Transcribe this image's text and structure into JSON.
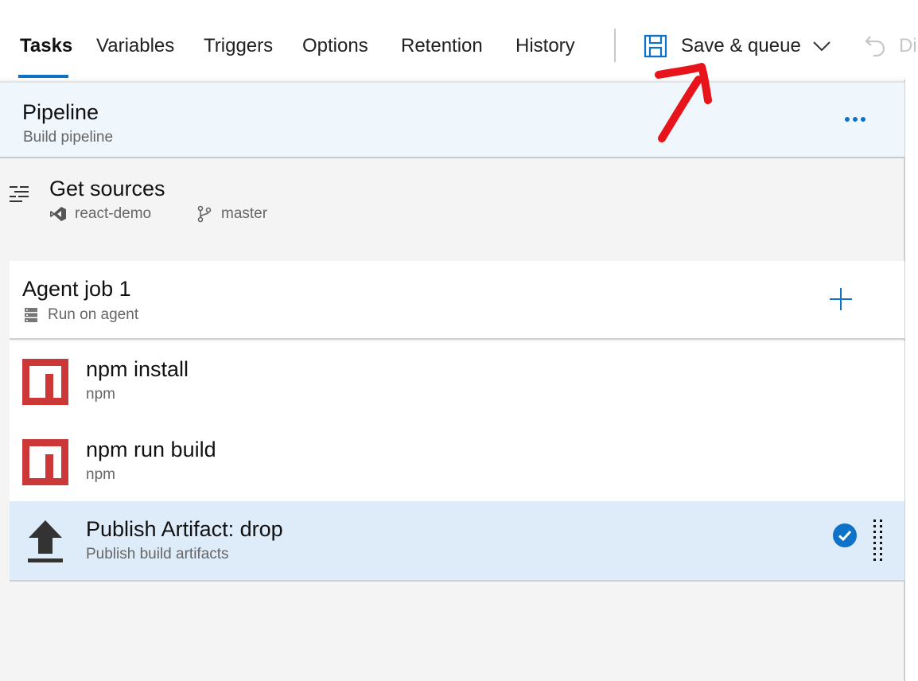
{
  "tabs": [
    {
      "label": "Tasks",
      "active": true
    },
    {
      "label": "Variables"
    },
    {
      "label": "Triggers"
    },
    {
      "label": "Options"
    },
    {
      "label": "Retention"
    },
    {
      "label": "History"
    }
  ],
  "toolbar": {
    "save_label": "Save & queue",
    "discard_label": "Di"
  },
  "pipeline": {
    "title": "Pipeline",
    "subtitle": "Build pipeline"
  },
  "sources": {
    "title": "Get sources",
    "repo": "react-demo",
    "branch": "master"
  },
  "job": {
    "title": "Agent job 1",
    "subtitle": "Run on agent"
  },
  "tasks": [
    {
      "title": "npm install",
      "subtitle": "npm"
    },
    {
      "title": "npm run build",
      "subtitle": "npm"
    },
    {
      "title": "Publish Artifact: drop",
      "subtitle": "Publish build artifacts",
      "selected": true
    }
  ],
  "colors": {
    "accent": "#0d72c8",
    "npm_red": "#cb3837",
    "selected_bg": "#deecf9",
    "annotation_red": "#e8141b"
  }
}
